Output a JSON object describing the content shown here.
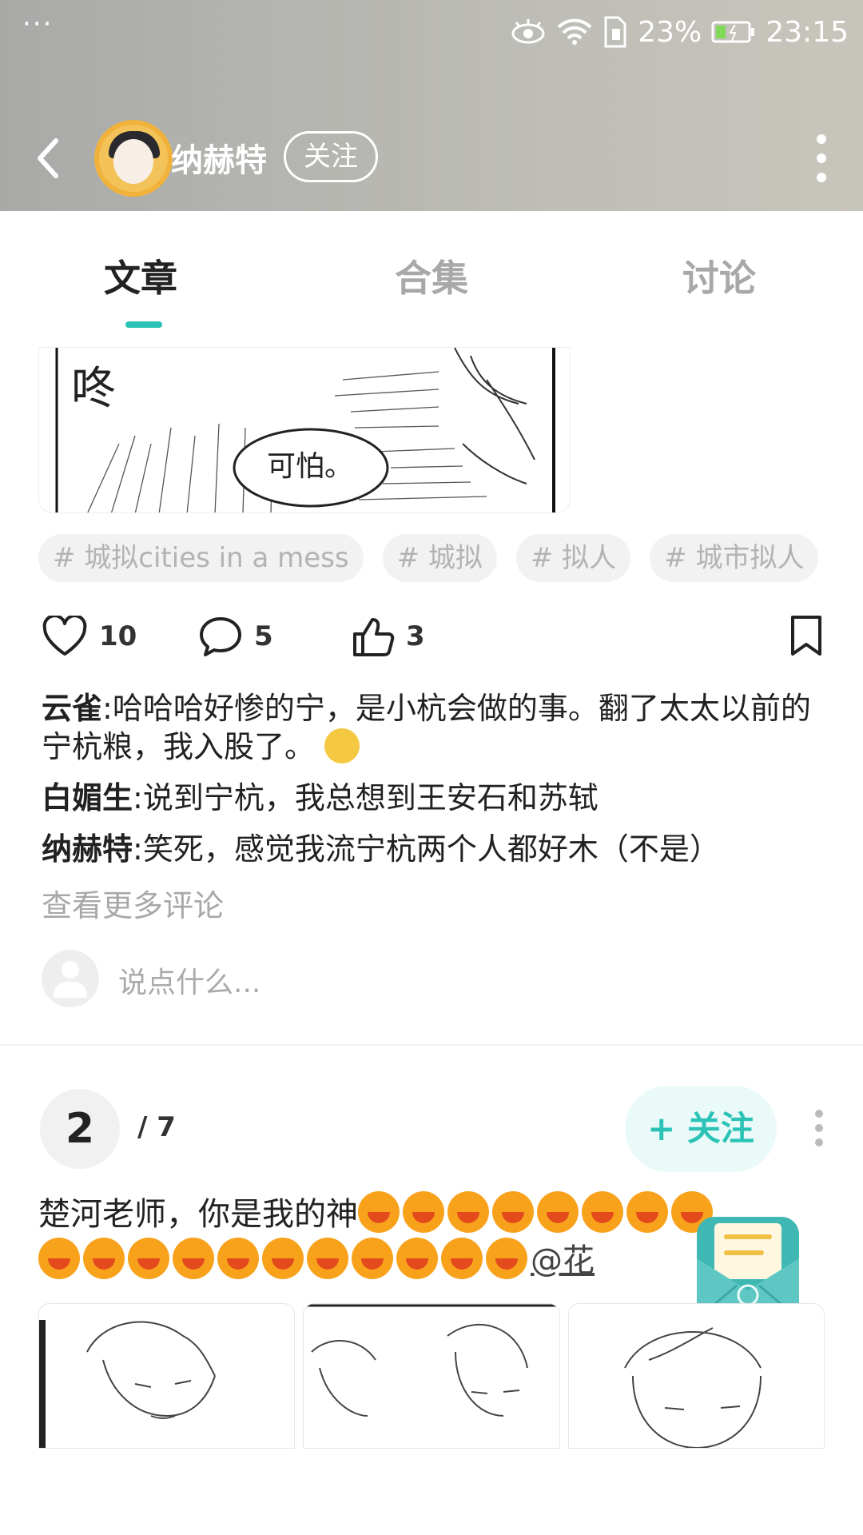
{
  "status_bar": {
    "menu_dots": "···",
    "battery_percent": "23%",
    "time": "23:15"
  },
  "header": {
    "username": "纳赫特",
    "follow_label": "关注"
  },
  "tabs": [
    {
      "label": "文章",
      "active": true
    },
    {
      "label": "合集",
      "active": false
    },
    {
      "label": "讨论",
      "active": false
    }
  ],
  "post1": {
    "comic_text": {
      "sound": "咚",
      "bubble": "可怕。"
    },
    "tags": [
      "# 城拟cities in a mess",
      "# 城拟",
      "# 拟人",
      "# 城市拟人"
    ],
    "actions": {
      "likes": "10",
      "comments": "5",
      "upvotes": "3"
    },
    "comments": [
      {
        "author": "云雀",
        "text": ":哈哈哈好惨的宁，是小杭会做的事。翻了太太以前的宁杭粮，我入股了。"
      },
      {
        "author": "白媚生",
        "text": ":说到宁杭，我总想到王安石和苏轼"
      },
      {
        "author": "纳赫特",
        "text": ":笑死，感觉我流宁杭两个人都好木（不是）"
      }
    ],
    "view_more": "查看更多评论",
    "reply_placeholder": "说点什么..."
  },
  "post2": {
    "rank": "2",
    "total": "/ 7",
    "follow_label": "+ 关注",
    "text_line1": "楚河老师，你是我的神",
    "text_line2_missing": "",
    "mention": "@花",
    "sob_count_line1": 8,
    "sob_count_line2": 11
  },
  "colors": {
    "accent": "#2cc3b7",
    "header_bg": "#b5b5b0"
  }
}
